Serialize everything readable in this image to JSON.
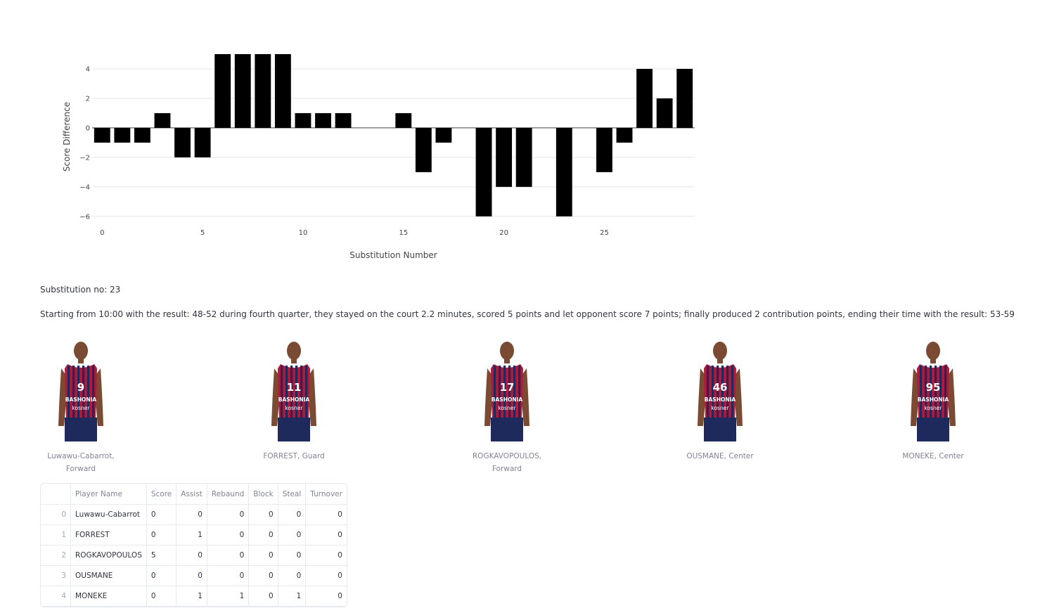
{
  "chart_data": {
    "type": "bar",
    "x": [
      0,
      1,
      2,
      3,
      4,
      5,
      6,
      7,
      8,
      9,
      10,
      11,
      12,
      13,
      14,
      15,
      16,
      17,
      18,
      19,
      20,
      21,
      22,
      23,
      24,
      25,
      26,
      27,
      28,
      29
    ],
    "values": [
      -1,
      -1,
      -1,
      1,
      -2,
      -2,
      5,
      5,
      5,
      5,
      1,
      1,
      1,
      0,
      0,
      1,
      -3,
      -1,
      0,
      -6,
      -4,
      -4,
      0,
      -6,
      0,
      -3,
      -1,
      4,
      2,
      4
    ],
    "xlabel": "Substitution Number",
    "ylabel": "Score Difference",
    "xticks": [
      0,
      5,
      10,
      15,
      20,
      25
    ],
    "yticks": [
      -6,
      -4,
      -2,
      0,
      2,
      4
    ],
    "ylim": [
      -6.2,
      5
    ],
    "bar_color": "#000000",
    "grid": true
  },
  "substitution_label": "Substitution no: 23",
  "summary": "Starting from 10:00 with the result: 48-52 during fourth quarter, they stayed on the court 2.2 minutes, scored 5 points and let opponent score 7 points; finally produced 2 contribution points, ending their time with the result: 53-59",
  "players": [
    {
      "line1": "Luwawu-Cabarrot,",
      "line2": "Forward",
      "number": "9"
    },
    {
      "line1": "FORREST, Guard",
      "line2": "",
      "number": "11"
    },
    {
      "line1": "ROGKAVOPOULOS,",
      "line2": "Forward",
      "number": "17"
    },
    {
      "line1": "OUSMANE, Center",
      "line2": "",
      "number": "46"
    },
    {
      "line1": "MONEKE, Center",
      "line2": "",
      "number": "95"
    }
  ],
  "jersey": {
    "club": "BASHONIA",
    "sponsor": "kosner",
    "colors": {
      "red": "#b5173a",
      "navy": "#1f2a5c"
    }
  },
  "table": {
    "columns": [
      "",
      "Player Name",
      "Score",
      "Assist",
      "Rebaund",
      "Block",
      "Steal",
      "Turnover"
    ],
    "rows": [
      [
        "0",
        "Luwawu-Cabarrot",
        "0",
        "0",
        "0",
        "0",
        "0",
        "0"
      ],
      [
        "1",
        "FORREST",
        "0",
        "1",
        "0",
        "0",
        "0",
        "0"
      ],
      [
        "2",
        "ROGKAVOPOULOS",
        "5",
        "0",
        "0",
        "0",
        "0",
        "0"
      ],
      [
        "3",
        "OUSMANE",
        "0",
        "0",
        "0",
        "0",
        "0",
        "0"
      ],
      [
        "4",
        "MONEKE",
        "0",
        "1",
        "1",
        "0",
        "1",
        "0"
      ]
    ]
  }
}
